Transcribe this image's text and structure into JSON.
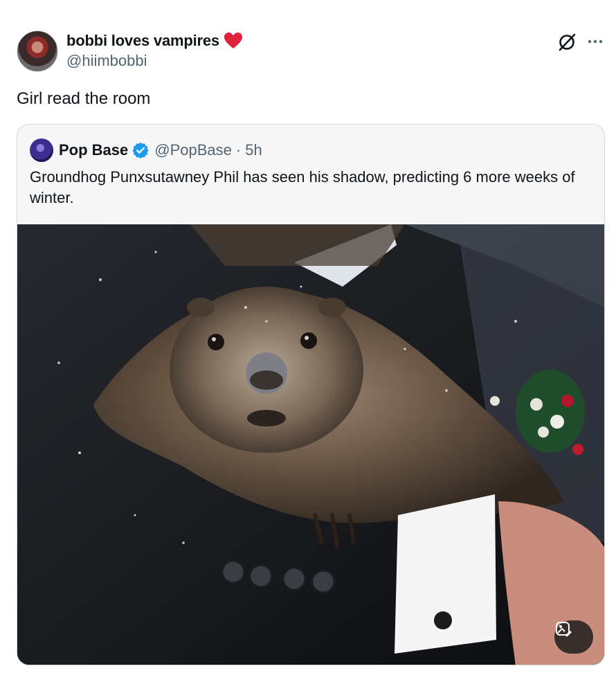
{
  "post": {
    "author_name": "bobbi loves vampires",
    "author_handle": "@hiimbobbi",
    "text": "Girl read the room",
    "icons": [
      "heart-icon",
      "grok-icon",
      "more-icon"
    ]
  },
  "quote": {
    "author_name": "Pop Base",
    "author_handle": "@PopBase",
    "separator": "·",
    "time": "5h",
    "text": "Groundhog Punxsutawney Phil has seen his shadow, predicting 6 more weeks of winter.",
    "verified_color": "#1d9bf0",
    "image_description_icon": "edit-image-icon"
  },
  "colors": {
    "heart": "#f4212e",
    "secondary_text": "#536471",
    "border": "#cfd9de"
  }
}
